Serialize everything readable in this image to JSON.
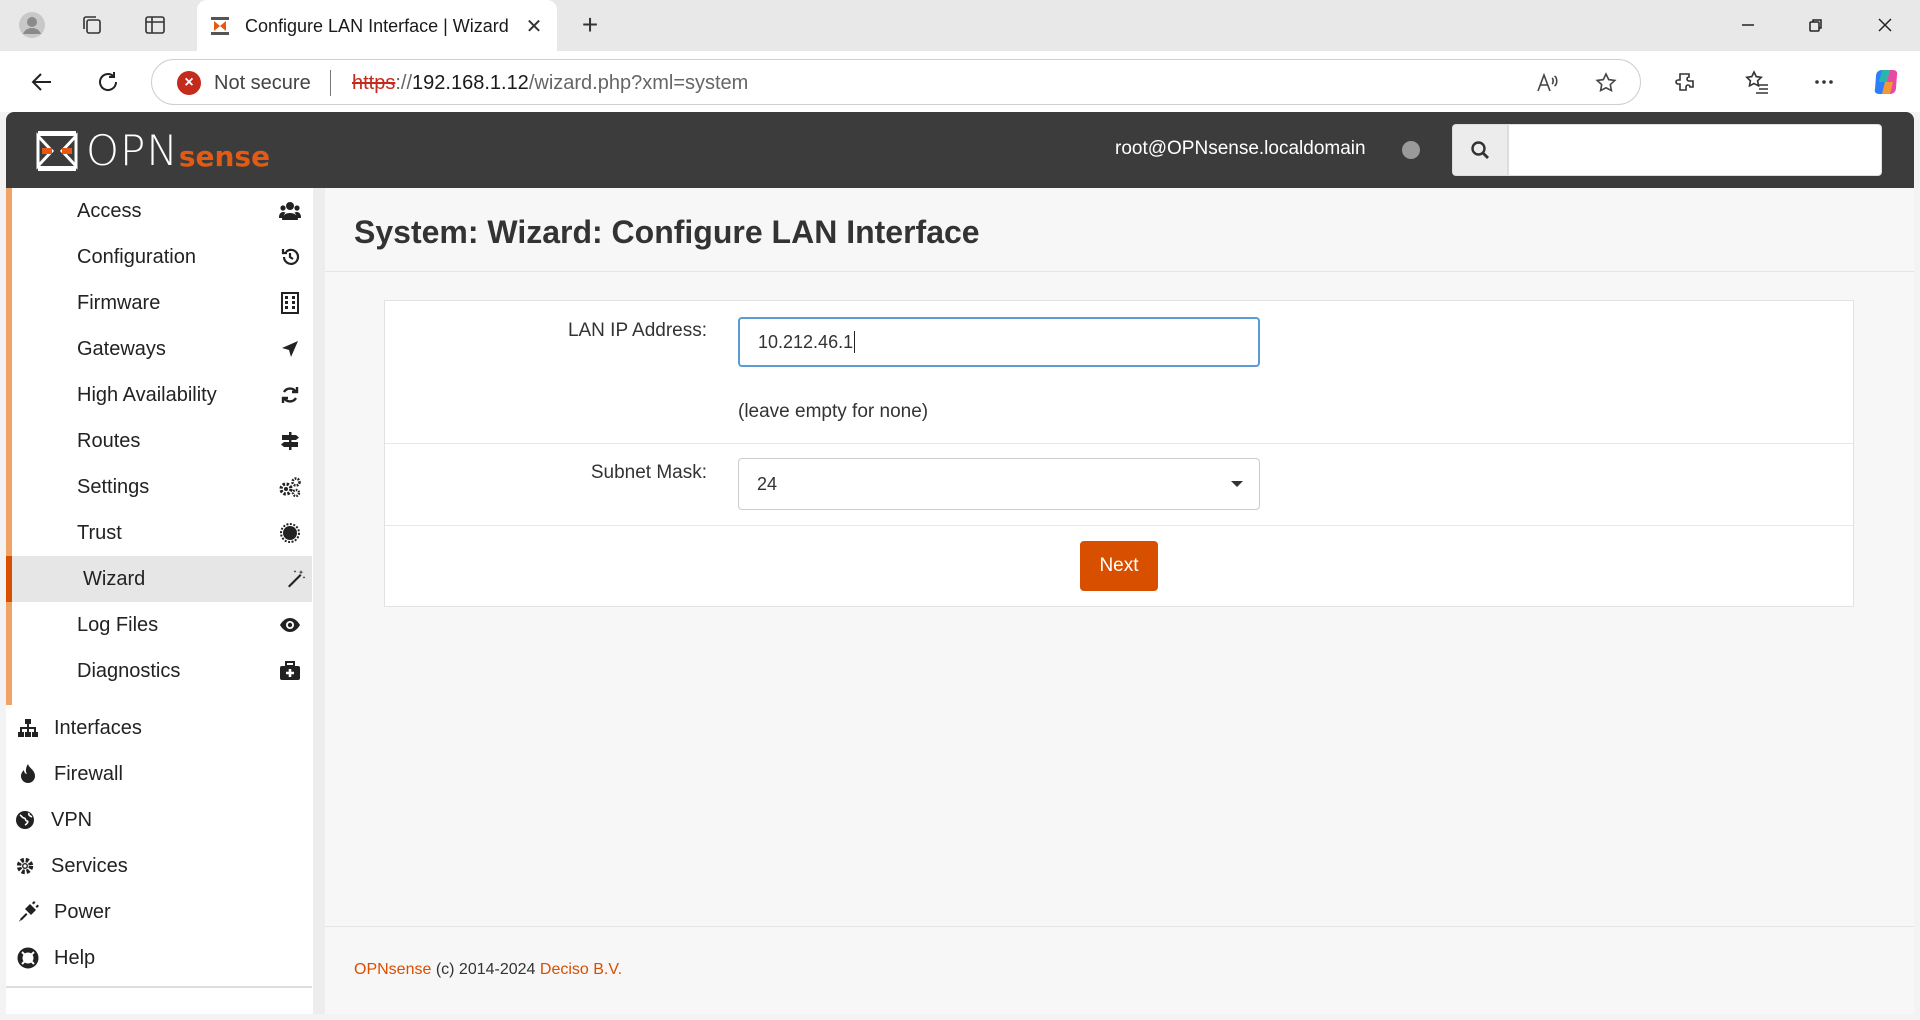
{
  "browser": {
    "tab_title": "Configure LAN Interface | Wizard",
    "tab_close": "✕",
    "new_tab": "+",
    "security_label": "Not secure",
    "url_protocol": "https",
    "url_sep": "://",
    "url_host": "192.168.1.12",
    "url_path": "/wizard.php?xml=system"
  },
  "header": {
    "logo_opn": "OPN",
    "logo_sense": "sense",
    "user": "root@OPNsense.localdomain"
  },
  "sidebar": {
    "submenu": [
      {
        "label": "Access",
        "icon": "users-icon"
      },
      {
        "label": "Configuration",
        "icon": "history-icon"
      },
      {
        "label": "Firmware",
        "icon": "building-icon"
      },
      {
        "label": "Gateways",
        "icon": "location-arrow-icon"
      },
      {
        "label": "High Availability",
        "icon": "refresh-icon"
      },
      {
        "label": "Routes",
        "icon": "signpost-icon"
      },
      {
        "label": "Settings",
        "icon": "cogs-icon"
      },
      {
        "label": "Trust",
        "icon": "certificate-icon"
      },
      {
        "label": "Wizard",
        "icon": "magic-wand-icon",
        "active": true
      },
      {
        "label": "Log Files",
        "icon": "eye-icon"
      },
      {
        "label": "Diagnostics",
        "icon": "medkit-icon"
      }
    ],
    "main": [
      {
        "label": "Interfaces",
        "icon": "sitemap-icon"
      },
      {
        "label": "Firewall",
        "icon": "fire-icon"
      },
      {
        "label": "VPN",
        "icon": "globe-icon"
      },
      {
        "label": "Services",
        "icon": "cog-icon"
      },
      {
        "label": "Power",
        "icon": "plug-icon"
      },
      {
        "label": "Help",
        "icon": "lifebuoy-icon"
      }
    ]
  },
  "content": {
    "title": "System: Wizard: Configure LAN Interface",
    "lan_ip_label": "LAN IP Address:",
    "lan_ip_value": "10.212.46.1",
    "lan_ip_hint": "(leave empty for none)",
    "subnet_label": "Subnet Mask:",
    "subnet_value": "24",
    "next_label": "Next"
  },
  "footer": {
    "brand": "OPNsense",
    "copyright": " (c) 2014-2024 ",
    "company": "Deciso B.V."
  },
  "colors": {
    "accent": "#d94f00",
    "header_bg": "#3c3c3c",
    "submenu_border": "#f0a267"
  }
}
